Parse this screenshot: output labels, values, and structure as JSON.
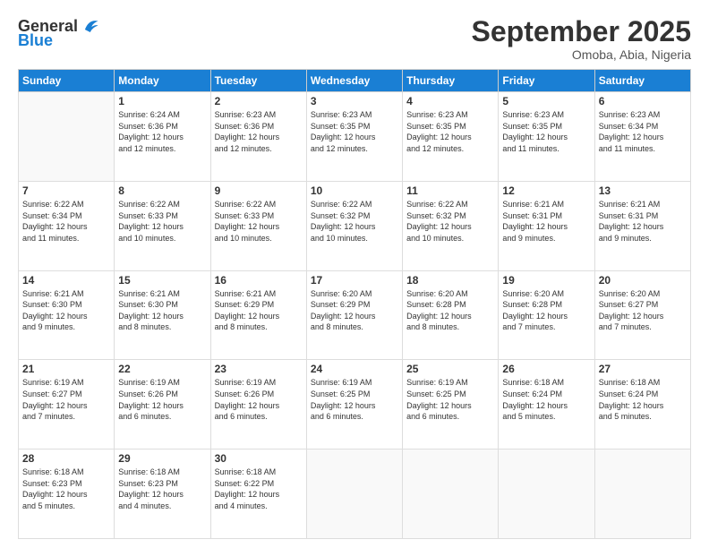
{
  "logo": {
    "general": "General",
    "blue": "Blue"
  },
  "header": {
    "month": "September 2025",
    "location": "Omoba, Abia, Nigeria"
  },
  "weekdays": [
    "Sunday",
    "Monday",
    "Tuesday",
    "Wednesday",
    "Thursday",
    "Friday",
    "Saturday"
  ],
  "weeks": [
    [
      {
        "day": "",
        "info": ""
      },
      {
        "day": "1",
        "info": "Sunrise: 6:24 AM\nSunset: 6:36 PM\nDaylight: 12 hours\nand 12 minutes."
      },
      {
        "day": "2",
        "info": "Sunrise: 6:23 AM\nSunset: 6:36 PM\nDaylight: 12 hours\nand 12 minutes."
      },
      {
        "day": "3",
        "info": "Sunrise: 6:23 AM\nSunset: 6:35 PM\nDaylight: 12 hours\nand 12 minutes."
      },
      {
        "day": "4",
        "info": "Sunrise: 6:23 AM\nSunset: 6:35 PM\nDaylight: 12 hours\nand 12 minutes."
      },
      {
        "day": "5",
        "info": "Sunrise: 6:23 AM\nSunset: 6:35 PM\nDaylight: 12 hours\nand 11 minutes."
      },
      {
        "day": "6",
        "info": "Sunrise: 6:23 AM\nSunset: 6:34 PM\nDaylight: 12 hours\nand 11 minutes."
      }
    ],
    [
      {
        "day": "7",
        "info": "Sunrise: 6:22 AM\nSunset: 6:34 PM\nDaylight: 12 hours\nand 11 minutes."
      },
      {
        "day": "8",
        "info": "Sunrise: 6:22 AM\nSunset: 6:33 PM\nDaylight: 12 hours\nand 10 minutes."
      },
      {
        "day": "9",
        "info": "Sunrise: 6:22 AM\nSunset: 6:33 PM\nDaylight: 12 hours\nand 10 minutes."
      },
      {
        "day": "10",
        "info": "Sunrise: 6:22 AM\nSunset: 6:32 PM\nDaylight: 12 hours\nand 10 minutes."
      },
      {
        "day": "11",
        "info": "Sunrise: 6:22 AM\nSunset: 6:32 PM\nDaylight: 12 hours\nand 10 minutes."
      },
      {
        "day": "12",
        "info": "Sunrise: 6:21 AM\nSunset: 6:31 PM\nDaylight: 12 hours\nand 9 minutes."
      },
      {
        "day": "13",
        "info": "Sunrise: 6:21 AM\nSunset: 6:31 PM\nDaylight: 12 hours\nand 9 minutes."
      }
    ],
    [
      {
        "day": "14",
        "info": "Sunrise: 6:21 AM\nSunset: 6:30 PM\nDaylight: 12 hours\nand 9 minutes."
      },
      {
        "day": "15",
        "info": "Sunrise: 6:21 AM\nSunset: 6:30 PM\nDaylight: 12 hours\nand 8 minutes."
      },
      {
        "day": "16",
        "info": "Sunrise: 6:21 AM\nSunset: 6:29 PM\nDaylight: 12 hours\nand 8 minutes."
      },
      {
        "day": "17",
        "info": "Sunrise: 6:20 AM\nSunset: 6:29 PM\nDaylight: 12 hours\nand 8 minutes."
      },
      {
        "day": "18",
        "info": "Sunrise: 6:20 AM\nSunset: 6:28 PM\nDaylight: 12 hours\nand 8 minutes."
      },
      {
        "day": "19",
        "info": "Sunrise: 6:20 AM\nSunset: 6:28 PM\nDaylight: 12 hours\nand 7 minutes."
      },
      {
        "day": "20",
        "info": "Sunrise: 6:20 AM\nSunset: 6:27 PM\nDaylight: 12 hours\nand 7 minutes."
      }
    ],
    [
      {
        "day": "21",
        "info": "Sunrise: 6:19 AM\nSunset: 6:27 PM\nDaylight: 12 hours\nand 7 minutes."
      },
      {
        "day": "22",
        "info": "Sunrise: 6:19 AM\nSunset: 6:26 PM\nDaylight: 12 hours\nand 6 minutes."
      },
      {
        "day": "23",
        "info": "Sunrise: 6:19 AM\nSunset: 6:26 PM\nDaylight: 12 hours\nand 6 minutes."
      },
      {
        "day": "24",
        "info": "Sunrise: 6:19 AM\nSunset: 6:25 PM\nDaylight: 12 hours\nand 6 minutes."
      },
      {
        "day": "25",
        "info": "Sunrise: 6:19 AM\nSunset: 6:25 PM\nDaylight: 12 hours\nand 6 minutes."
      },
      {
        "day": "26",
        "info": "Sunrise: 6:18 AM\nSunset: 6:24 PM\nDaylight: 12 hours\nand 5 minutes."
      },
      {
        "day": "27",
        "info": "Sunrise: 6:18 AM\nSunset: 6:24 PM\nDaylight: 12 hours\nand 5 minutes."
      }
    ],
    [
      {
        "day": "28",
        "info": "Sunrise: 6:18 AM\nSunset: 6:23 PM\nDaylight: 12 hours\nand 5 minutes."
      },
      {
        "day": "29",
        "info": "Sunrise: 6:18 AM\nSunset: 6:23 PM\nDaylight: 12 hours\nand 4 minutes."
      },
      {
        "day": "30",
        "info": "Sunrise: 6:18 AM\nSunset: 6:22 PM\nDaylight: 12 hours\nand 4 minutes."
      },
      {
        "day": "",
        "info": ""
      },
      {
        "day": "",
        "info": ""
      },
      {
        "day": "",
        "info": ""
      },
      {
        "day": "",
        "info": ""
      }
    ]
  ]
}
